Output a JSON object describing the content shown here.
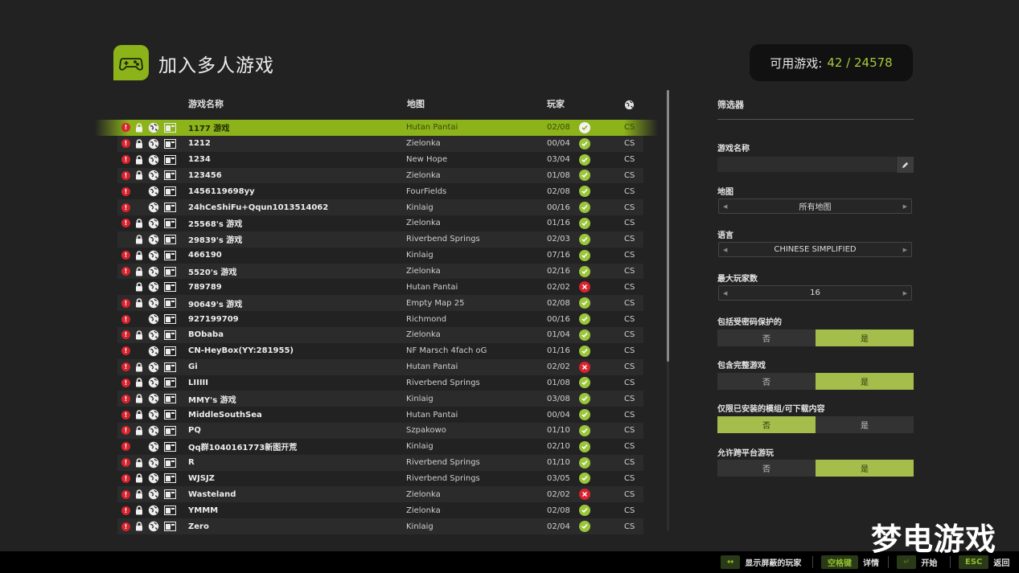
{
  "header": {
    "title": "加入多人游戏",
    "icon": "gamepad-icon",
    "accent": "#8cb31a"
  },
  "counter": {
    "label": "可用游戏:",
    "value": "42 / 24578"
  },
  "columns": {
    "name": "游戏名称",
    "map": "地图",
    "players": "玩家"
  },
  "servers": [
    {
      "warn": true,
      "lock": true,
      "name": "1177 游戏",
      "map": "Hutan Pantai",
      "players": "02/08",
      "status": "ok",
      "lang": "CS",
      "selected": true
    },
    {
      "warn": true,
      "lock": true,
      "name": "1212",
      "map": "Zielonka",
      "players": "00/04",
      "status": "ok",
      "lang": "CS"
    },
    {
      "warn": true,
      "lock": true,
      "name": "1234",
      "map": "New Hope",
      "players": "03/04",
      "status": "ok",
      "lang": "CS"
    },
    {
      "warn": true,
      "lock": true,
      "name": "123456",
      "map": "Zielonka",
      "players": "01/08",
      "status": "ok",
      "lang": "CS"
    },
    {
      "warn": true,
      "lock": false,
      "name": "1456119698yy",
      "map": "FourFields",
      "players": "02/08",
      "status": "ok",
      "lang": "CS"
    },
    {
      "warn": true,
      "lock": false,
      "name": "24hCeShiFu+Qqun1013514062",
      "map": "Kinlaig",
      "players": "00/16",
      "status": "ok",
      "lang": "CS"
    },
    {
      "warn": true,
      "lock": true,
      "name": "25568's 游戏",
      "map": "Zielonka",
      "players": "01/16",
      "status": "ok",
      "lang": "CS"
    },
    {
      "warn": false,
      "lock": true,
      "name": "29839's 游戏",
      "map": "Riverbend Springs",
      "players": "02/03",
      "status": "ok",
      "lang": "CS"
    },
    {
      "warn": true,
      "lock": true,
      "name": "466190",
      "map": "Kinlaig",
      "players": "07/16",
      "status": "ok",
      "lang": "CS"
    },
    {
      "warn": true,
      "lock": true,
      "name": "5520's 游戏",
      "map": "Zielonka",
      "players": "02/16",
      "status": "ok",
      "lang": "CS"
    },
    {
      "warn": false,
      "lock": true,
      "name": "789789",
      "map": "Hutan Pantai",
      "players": "02/02",
      "status": "full",
      "lang": "CS"
    },
    {
      "warn": true,
      "lock": true,
      "name": "90649's 游戏",
      "map": "Empty Map 25",
      "players": "02/08",
      "status": "ok",
      "lang": "CS"
    },
    {
      "warn": true,
      "lock": false,
      "name": "927199709",
      "map": "Richmond",
      "players": "00/16",
      "status": "ok",
      "lang": "CS"
    },
    {
      "warn": true,
      "lock": true,
      "name": "BObaba",
      "map": "Zielonka",
      "players": "01/04",
      "status": "ok",
      "lang": "CS"
    },
    {
      "warn": true,
      "lock": false,
      "name": "CN-HeyBox(YY:281955)",
      "map": "NF Marsch 4fach oG",
      "players": "01/16",
      "status": "ok",
      "lang": "CS"
    },
    {
      "warn": true,
      "lock": true,
      "name": "Gi",
      "map": "Hutan Pantai",
      "players": "02/02",
      "status": "full",
      "lang": "CS"
    },
    {
      "warn": true,
      "lock": true,
      "name": "LIIIII",
      "map": "Riverbend Springs",
      "players": "01/08",
      "status": "ok",
      "lang": "CS"
    },
    {
      "warn": true,
      "lock": true,
      "name": "MMY's 游戏",
      "map": "Kinlaig",
      "players": "03/08",
      "status": "ok",
      "lang": "CS"
    },
    {
      "warn": true,
      "lock": true,
      "name": "MiddleSouthSea",
      "map": "Hutan Pantai",
      "players": "00/04",
      "status": "ok",
      "lang": "CS"
    },
    {
      "warn": true,
      "lock": true,
      "name": "PQ",
      "map": "Szpakowo",
      "players": "01/10",
      "status": "ok",
      "lang": "CS"
    },
    {
      "warn": true,
      "lock": false,
      "name": "Qq群1040161773新图开荒",
      "map": "Kinlaig",
      "players": "02/10",
      "status": "ok",
      "lang": "CS"
    },
    {
      "warn": true,
      "lock": true,
      "name": "R",
      "map": "Riverbend Springs",
      "players": "01/10",
      "status": "ok",
      "lang": "CS"
    },
    {
      "warn": true,
      "lock": true,
      "name": "WJSJZ",
      "map": "Riverbend Springs",
      "players": "03/05",
      "status": "ok",
      "lang": "CS"
    },
    {
      "warn": true,
      "lock": true,
      "name": "Wasteland",
      "map": "Zielonka",
      "players": "02/02",
      "status": "full",
      "lang": "CS"
    },
    {
      "warn": true,
      "lock": true,
      "name": "YMMM",
      "map": "Zielonka",
      "players": "02/08",
      "status": "ok",
      "lang": "CS"
    },
    {
      "warn": true,
      "lock": true,
      "name": "Zero",
      "map": "Kinlaig",
      "players": "02/04",
      "status": "ok",
      "lang": "CS"
    }
  ],
  "filters": {
    "title": "筛选器",
    "game_name_label": "游戏名称",
    "game_name_value": "",
    "map_label": "地图",
    "map_value": "所有地图",
    "language_label": "语言",
    "language_value": "CHINESE SIMPLIFIED",
    "max_players_label": "最大玩家数",
    "max_players_value": "16",
    "password_label": "包括受密码保护的",
    "full_label": "包含完整游戏",
    "mods_label": "仅限已安装的模组/可下载内容",
    "crossplay_label": "允许跨平台游玩",
    "no": "否",
    "yes": "是",
    "password_on": "yes",
    "full_on": "yes",
    "mods_on": "no",
    "crossplay_on": "yes"
  },
  "footer": {
    "show_hidden": "显示屏蔽的玩家",
    "space_key": "空格键",
    "details": "详情",
    "start": "开始",
    "esc_key": "ESC",
    "back": "返回"
  },
  "watermark": "梦电游戏"
}
